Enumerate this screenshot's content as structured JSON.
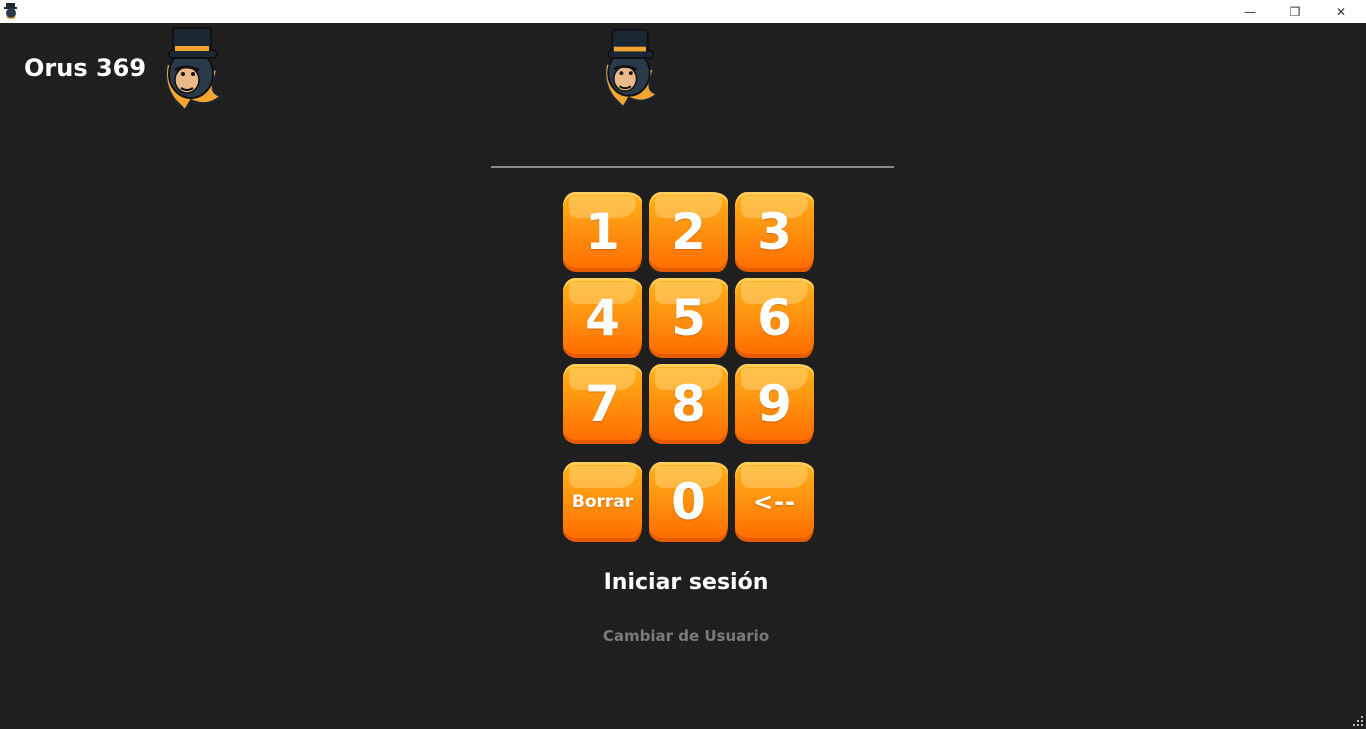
{
  "window": {
    "app_icon": "tophat-monkey-logo-icon",
    "controls": {
      "minimize": "—",
      "maximize": "❐",
      "close": "✕"
    }
  },
  "header": {
    "title": "Orus 369",
    "logo": "tophat-monkey-logo"
  },
  "login": {
    "pin_value": "",
    "keys": {
      "k1": "1",
      "k2": "2",
      "k3": "3",
      "k4": "4",
      "k5": "5",
      "k6": "6",
      "k7": "7",
      "k8": "8",
      "k9": "9",
      "clear": "Borrar",
      "k0": "0",
      "backspace": "<--"
    },
    "login_label": "Iniciar sesión",
    "switch_user_label": "Cambiar de Usuario"
  },
  "colors": {
    "background": "#1f1f1f",
    "key_top": "#ffb21a",
    "key_bottom": "#ff6a00",
    "muted_text": "#7a7a7a"
  }
}
